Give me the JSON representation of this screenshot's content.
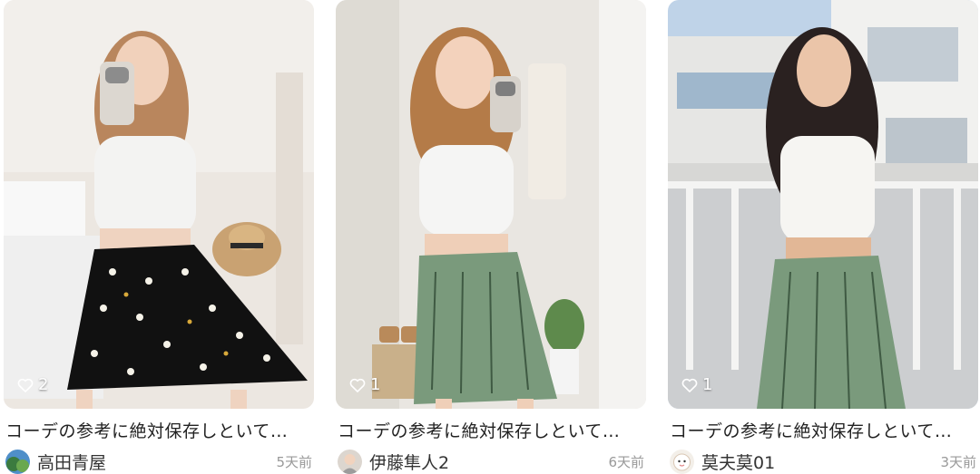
{
  "feed": {
    "cards": [
      {
        "likes": "2",
        "title": "コーデの参考に絶対保存しといて…",
        "author": "高田青屋",
        "time": "5天前"
      },
      {
        "likes": "1",
        "title": "コーデの参考に絶対保存しといて…",
        "author": "伊藤隼人2",
        "time": "6天前"
      },
      {
        "likes": "1",
        "title": "コーデの参考に絶対保存しといて…",
        "author": "莫夫莫01",
        "time": "3天前"
      }
    ]
  },
  "icons": {
    "like": "heart-outline-icon"
  },
  "colors": {
    "title_text": "#222222",
    "time_text": "#999999",
    "skirt_floral": "#111111",
    "skirt_green": "#7a9a7c"
  }
}
